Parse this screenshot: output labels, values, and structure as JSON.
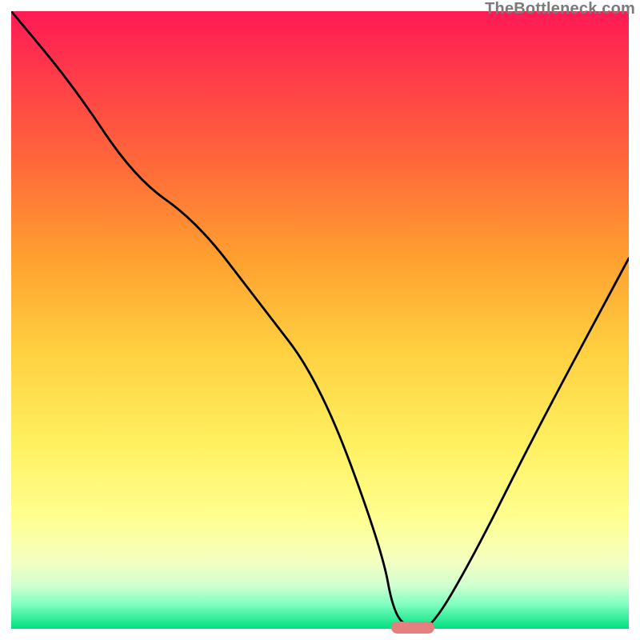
{
  "watermark": "TheBottleneck.com",
  "chart_data": {
    "type": "line",
    "title": "",
    "xlabel": "",
    "ylabel": "",
    "xlim": [
      0,
      100
    ],
    "ylim": [
      0,
      100
    ],
    "grid": false,
    "series": [
      {
        "name": "bottleneck-curve",
        "x": [
          0,
          10,
          20,
          30,
          40,
          50,
          60,
          62,
          65,
          68,
          75,
          85,
          100
        ],
        "y": [
          100,
          88,
          73,
          66,
          53,
          40,
          13,
          2,
          0,
          0,
          12,
          32,
          60
        ]
      }
    ],
    "marker": {
      "x_start": 62,
      "x_end": 68,
      "y": 0
    },
    "gradient_stops": [
      {
        "pos": 0,
        "color": "#ff1a55"
      },
      {
        "pos": 25,
        "color": "#ff6a3a"
      },
      {
        "pos": 55,
        "color": "#ffd040"
      },
      {
        "pos": 82,
        "color": "#ffff90"
      },
      {
        "pos": 100,
        "color": "#00e080"
      }
    ]
  }
}
